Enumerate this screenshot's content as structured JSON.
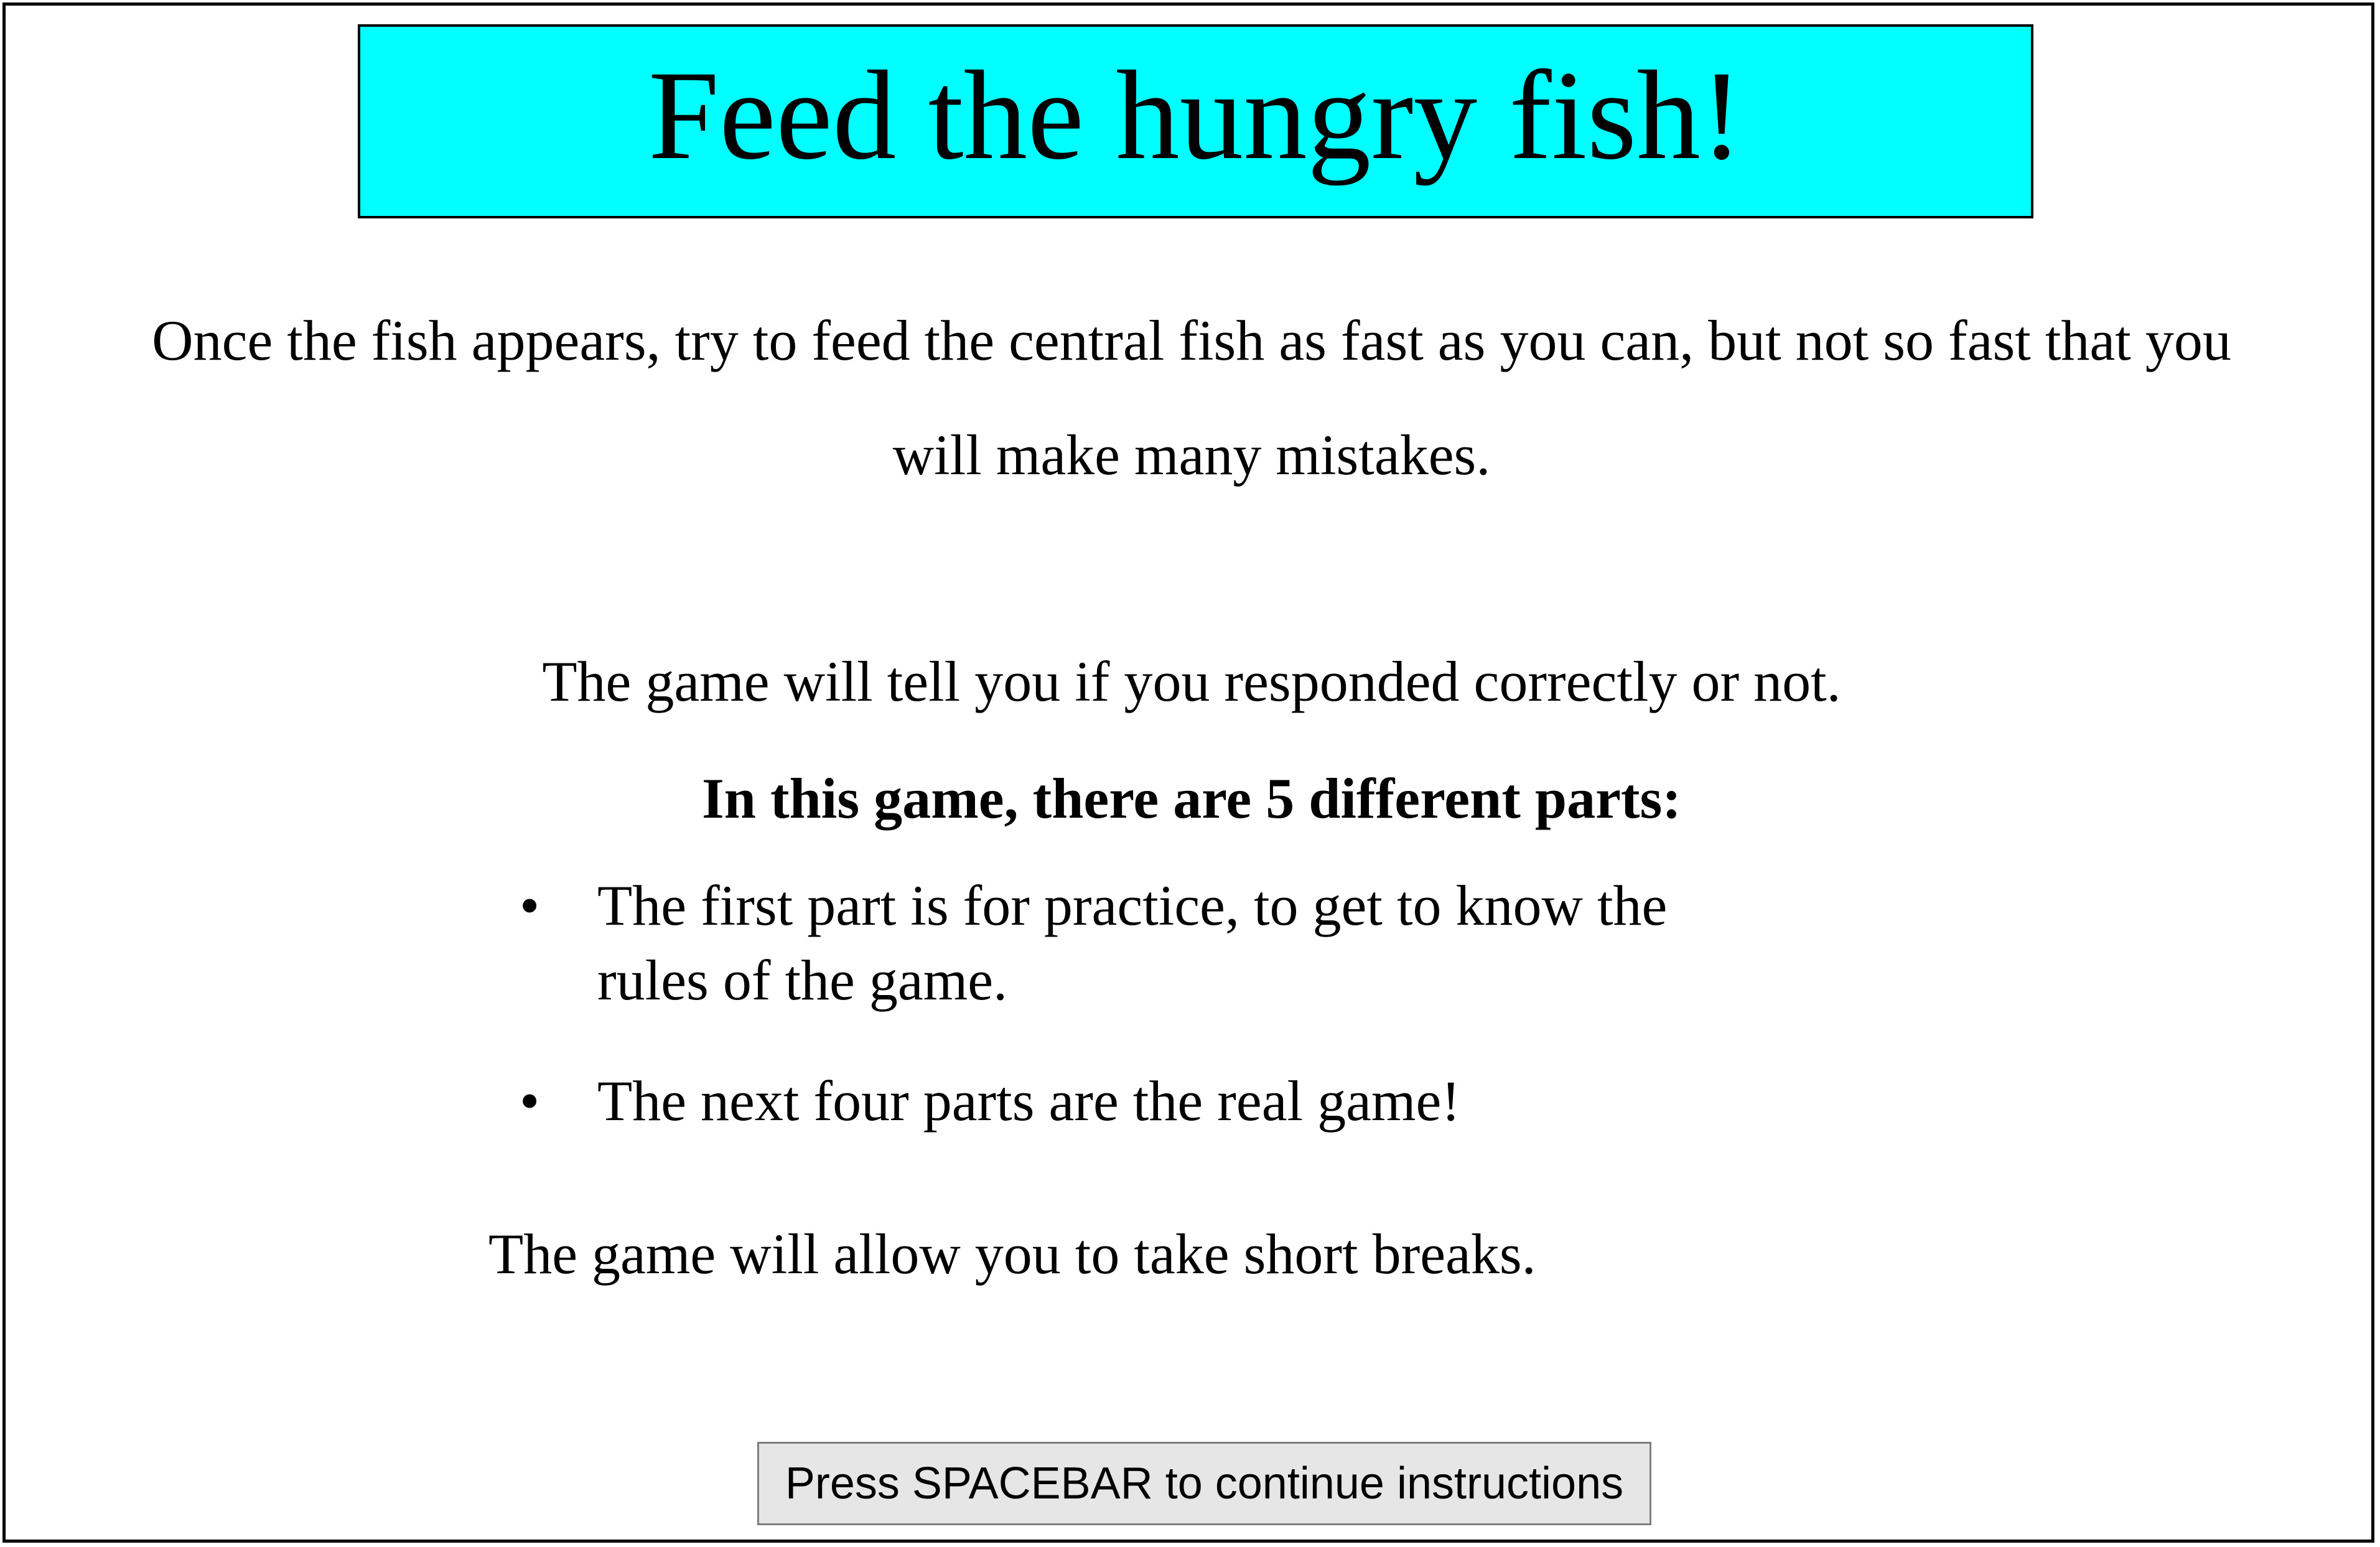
{
  "colors": {
    "title_background": "#00ffff",
    "button_background": "#e6e6e6",
    "button_border": "#7f7f7f",
    "text": "#000000"
  },
  "title": "Feed the hungry fish!",
  "instructions": {
    "intro_line_1": "Once the fish appears, try to feed the central fish as fast as you can, but not so fast that you",
    "intro_line_2": "will make many mistakes.",
    "feedback": "The game will tell you if you responded correctly or not.",
    "parts_heading": "In this game, there are 5 different parts:",
    "bullet_glyph": "•",
    "bullets": [
      {
        "line_1": "The first part is for practice, to get to know the",
        "line_2": "rules of the game."
      },
      {
        "line_1": "The next four parts are the real game!"
      }
    ],
    "breaks": "The game will allow you to take short breaks."
  },
  "continue_button": {
    "label": "Press SPACEBAR to continue instructions"
  }
}
